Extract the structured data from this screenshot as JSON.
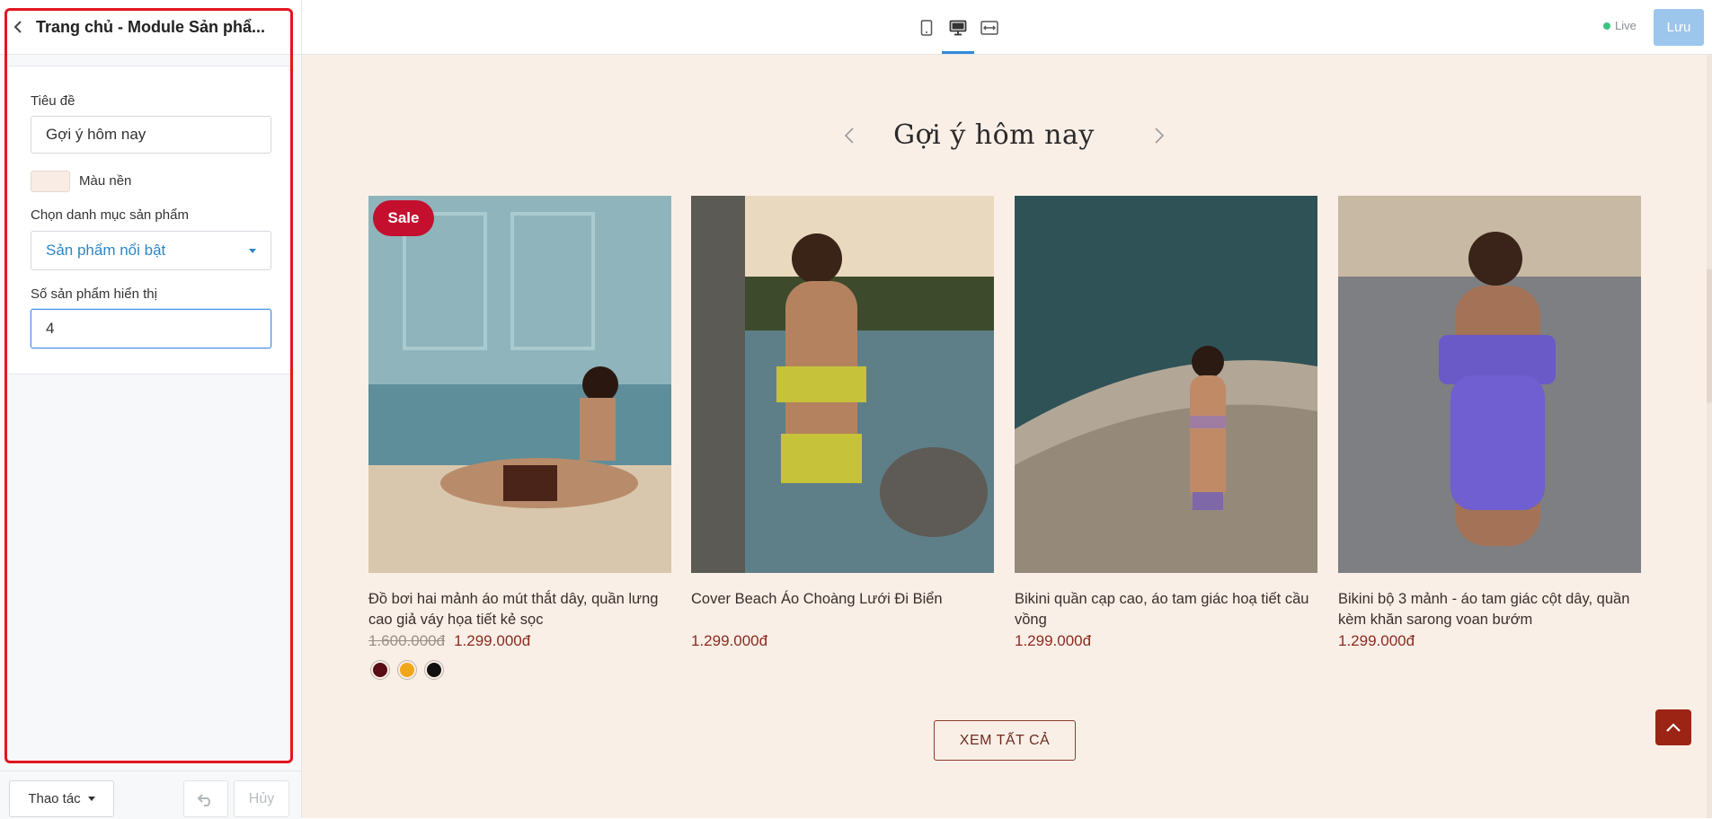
{
  "panel": {
    "title": "Trang chủ - Module Sản phẩ...",
    "fields": {
      "title_label": "Tiêu đề",
      "title_value": "Gợi ý hôm nay",
      "bg_color_label": "Màu nền",
      "bg_color_value": "#f9ece4",
      "category_label": "Chọn danh mục sản phẩm",
      "category_value": "Sản phẩm nổi bật",
      "count_label": "Số sản phẩm hiển thị",
      "count_value": "4"
    },
    "footer": {
      "actions_label": "Thao tác",
      "cancel_label": "Hủy"
    }
  },
  "toolbar": {
    "devices": [
      "mobile-icon",
      "desktop-icon",
      "fullwidth-icon"
    ],
    "active_device": "desktop-icon",
    "status": "Live",
    "save_label": "Lưu"
  },
  "preview": {
    "section_title": "Gợi ý hôm nay",
    "products": [
      {
        "name": "Đồ bơi hai mảnh áo mút thắt dây, quần lưng cao giả váy họa tiết kẻ sọc",
        "old_price": "1.600.000đ",
        "price": "1.299.000đ",
        "badge": "Sale",
        "swatches": [
          "#5a0d14",
          "#f2a71b",
          "#111111"
        ]
      },
      {
        "name": "Cover Beach Áo Choàng Lưới Đi Biển",
        "old_price": "",
        "price": "1.299.000đ",
        "badge": "",
        "swatches": []
      },
      {
        "name": "Bikini quần cạp cao, áo tam giác hoạ tiết cầu vồng",
        "old_price": "",
        "price": "1.299.000đ",
        "badge": "",
        "swatches": []
      },
      {
        "name": "Bikini bộ 3 mảnh - áo tam giác cột dây, quần kèm khăn sarong voan bướm",
        "old_price": "",
        "price": "1.299.000đ",
        "badge": "",
        "swatches": []
      }
    ],
    "view_all_label": "XEM TẤT CẢ"
  },
  "colors": {
    "accent": "#2f8ad6",
    "highlight_outline": "#e0161f",
    "preview_bg": "#faefe7",
    "price": "#8b2b1f",
    "sale_badge": "#c40f2e"
  }
}
